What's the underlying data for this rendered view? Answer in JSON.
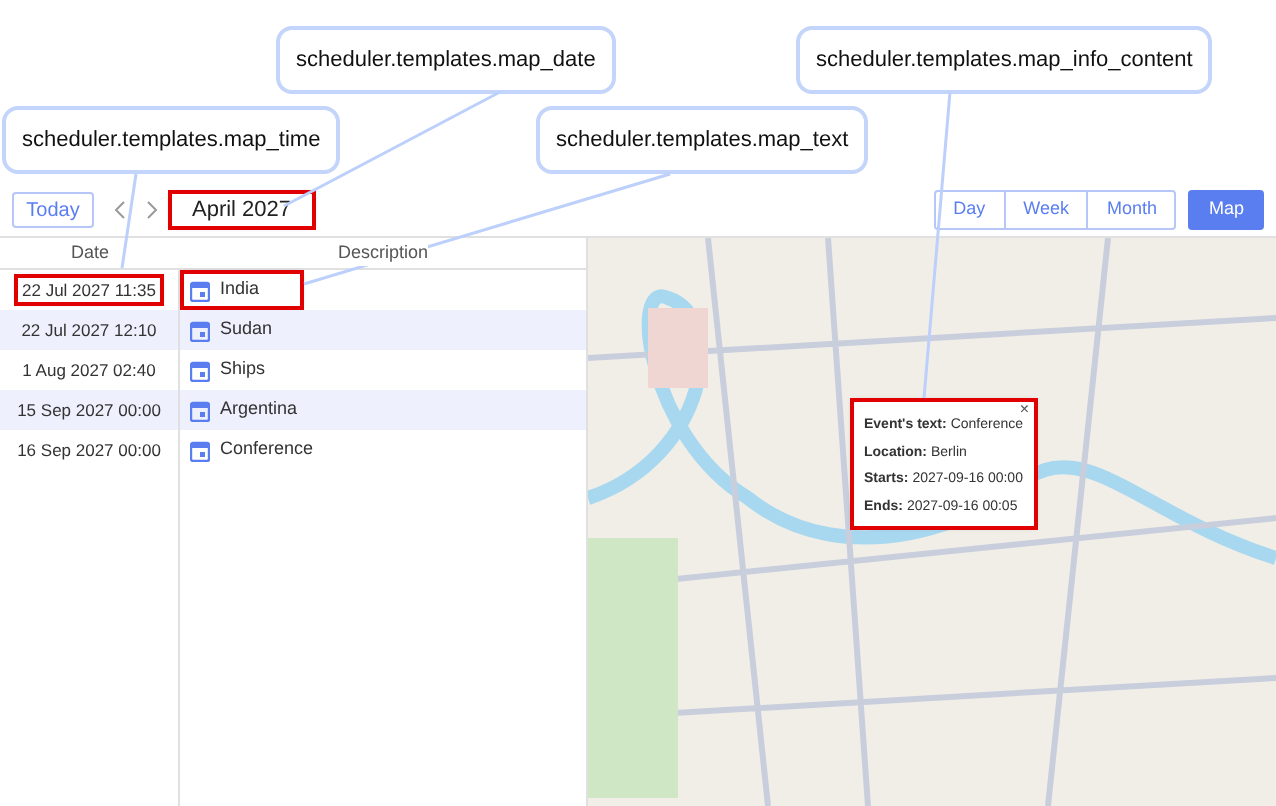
{
  "annotations": [
    {
      "text": "scheduler.templates.map_date"
    },
    {
      "text": "scheduler.templates.map_time"
    },
    {
      "text": "scheduler.templates.map_text"
    },
    {
      "text": "scheduler.templates.map_info_content"
    }
  ],
  "toolbar": {
    "today": "Today",
    "date_title": "April 2027",
    "date_highlighted": true,
    "views": [
      {
        "label": "Day",
        "selected": false
      },
      {
        "label": "Week",
        "selected": false
      },
      {
        "label": "Month",
        "selected": false
      },
      {
        "label": "Map",
        "selected": true
      }
    ]
  },
  "table": {
    "columns": [
      "Date",
      "Description"
    ],
    "rows": [
      {
        "date": "22 Jul 2027 11:35",
        "text": "India",
        "highlighted": true
      },
      {
        "date": "22 Jul 2027 12:10",
        "text": "Sudan",
        "highlighted": false
      },
      {
        "date": "1 Aug 2027 02:40",
        "text": "Ships",
        "highlighted": false
      },
      {
        "date": "15 Sep 2027 00:00",
        "text": "Argentina",
        "highlighted": false
      },
      {
        "date": "16 Sep 2027 00:00",
        "text": "Conference",
        "highlighted": false
      }
    ]
  },
  "popup": {
    "close": "×",
    "highlighted": true,
    "fields": [
      {
        "label": "Event's text:",
        "value": "Conference"
      },
      {
        "label": "Location:",
        "value": "Berlin"
      },
      {
        "label": "Starts:",
        "value": "2027-09-16 00:00"
      },
      {
        "label": "Ends:",
        "value": "2027-09-16 00:05"
      }
    ]
  }
}
